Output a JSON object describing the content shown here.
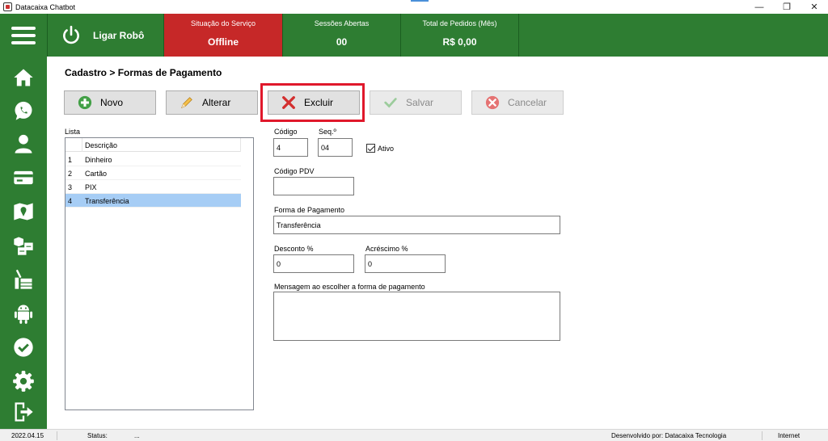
{
  "window": {
    "title": "Datacaixa Chatbot",
    "controls": [
      "—",
      "❐",
      "✕"
    ]
  },
  "header": {
    "menu_icon": "hamburger-icon",
    "robot_label": "Ligar Robô",
    "stats": [
      {
        "title": "Situação do Serviço",
        "value": "Offline",
        "color": "#c62828"
      },
      {
        "title": "Sessões Abertas",
        "value": "00",
        "color": "#2e7d32"
      },
      {
        "title": "Total de Pedidos (Mês)",
        "value": "R$ 0,00",
        "color": "#2e7d32"
      }
    ]
  },
  "sidebar": {
    "items": [
      {
        "icon": "home-icon"
      },
      {
        "icon": "whatsapp-icon"
      },
      {
        "icon": "user-icon"
      },
      {
        "icon": "credit-card-icon"
      },
      {
        "icon": "map-icon"
      },
      {
        "icon": "boxes-icon"
      },
      {
        "icon": "delivery-icon"
      },
      {
        "icon": "android-icon"
      },
      {
        "icon": "check-circle-icon"
      },
      {
        "icon": "gear-icon"
      },
      {
        "icon": "exit-icon"
      }
    ]
  },
  "breadcrumb": "Cadastro > Formas de Pagamento",
  "toolbar": {
    "novo": "Novo",
    "alterar": "Alterar",
    "excluir": "Excluir",
    "salvar": "Salvar",
    "cancelar": "Cancelar"
  },
  "list": {
    "label": "Lista",
    "column": "Descrição",
    "rows": [
      {
        "num": "1",
        "desc": "Dinheiro"
      },
      {
        "num": "2",
        "desc": "Cartão"
      },
      {
        "num": "3",
        "desc": "PIX"
      },
      {
        "num": "4",
        "desc": "Transferência"
      }
    ],
    "selected_index": 3
  },
  "form": {
    "codigo_label": "Código",
    "codigo_value": "4",
    "seq_label": "Seq.º",
    "seq_value": "04",
    "ativo_label": "Ativo",
    "ativo_checked": true,
    "codigo_pdv_label": "Código PDV",
    "codigo_pdv_value": "",
    "forma_label": "Forma de Pagamento",
    "forma_value": "Transferência",
    "desconto_label": "Desconto %",
    "desconto_value": "0",
    "acrescimo_label": "Acréscimo %",
    "acrescimo_value": "0",
    "mensagem_label": "Mensagem ao escolher a forma de pagamento",
    "mensagem_value": ""
  },
  "statusbar": {
    "version": "2022.04.15",
    "status_label": "Status:",
    "status_value": "...",
    "developer": "Desenvolvido por: Datacaixa Tecnologia",
    "connection": "Internet"
  }
}
